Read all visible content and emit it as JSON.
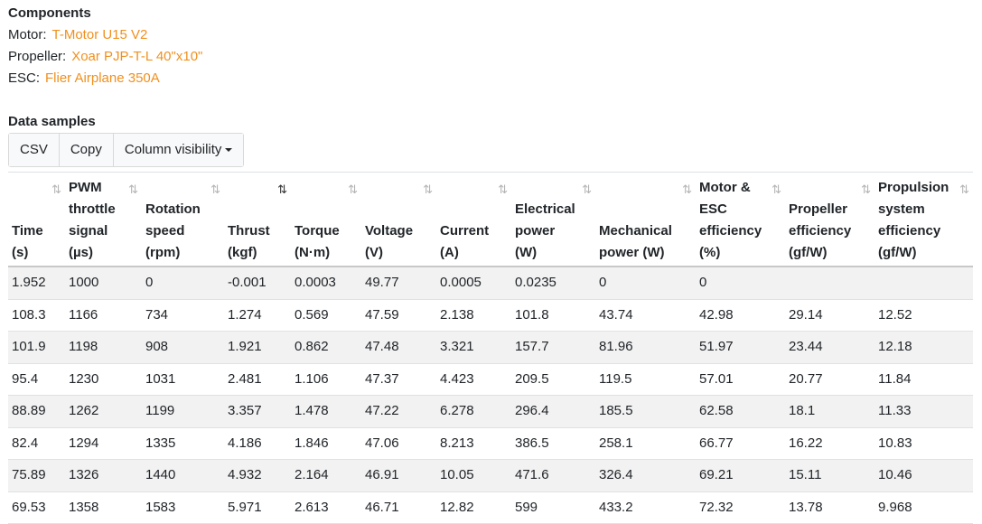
{
  "components": {
    "title": "Components",
    "motor_label": "Motor:",
    "motor_value": "T-Motor U15 V2",
    "propeller_label": "Propeller:",
    "propeller_value": "Xoar PJP-T-L 40\"x10\"",
    "esc_label": "ESC:",
    "esc_value": "Flier Airplane 350A"
  },
  "data_samples": {
    "title": "Data samples",
    "buttons": {
      "csv": "CSV",
      "copy": "Copy",
      "column_visibility": "Column visibility"
    }
  },
  "sort_icon": "⇅",
  "table": {
    "headers": [
      [
        "Time",
        "(s)"
      ],
      [
        "PWM",
        "throttle",
        "signal",
        "(µs)"
      ],
      [
        "Rotation",
        "speed",
        "(rpm)"
      ],
      [
        "Thrust",
        "(kgf)"
      ],
      [
        "Torque",
        "(N·m)"
      ],
      [
        "Voltage",
        "(V)"
      ],
      [
        "Current",
        "(A)"
      ],
      [
        "Electrical",
        "power",
        "(W)"
      ],
      [
        "Mechanical",
        "power (W)"
      ],
      [
        "Motor &",
        "ESC",
        "efficiency",
        "(%)"
      ],
      [
        "Propeller",
        "efficiency",
        "(gf/W)"
      ],
      [
        "Propulsion",
        "system",
        "efficiency",
        "(gf/W)"
      ]
    ],
    "rows": [
      [
        "1.952",
        "1000",
        "0",
        "-0.001",
        "0.0003",
        "49.77",
        "0.0005",
        "0.0235",
        "0",
        "0",
        "",
        ""
      ],
      [
        "108.3",
        "1166",
        "734",
        "1.274",
        "0.569",
        "47.59",
        "2.138",
        "101.8",
        "43.74",
        "42.98",
        "29.14",
        "12.52"
      ],
      [
        "101.9",
        "1198",
        "908",
        "1.921",
        "0.862",
        "47.48",
        "3.321",
        "157.7",
        "81.96",
        "51.97",
        "23.44",
        "12.18"
      ],
      [
        "95.4",
        "1230",
        "1031",
        "2.481",
        "1.106",
        "47.37",
        "4.423",
        "209.5",
        "119.5",
        "57.01",
        "20.77",
        "11.84"
      ],
      [
        "88.89",
        "1262",
        "1199",
        "3.357",
        "1.478",
        "47.22",
        "6.278",
        "296.4",
        "185.5",
        "62.58",
        "18.1",
        "11.33"
      ],
      [
        "82.4",
        "1294",
        "1335",
        "4.186",
        "1.846",
        "47.06",
        "8.213",
        "386.5",
        "258.1",
        "66.77",
        "16.22",
        "10.83"
      ],
      [
        "75.89",
        "1326",
        "1440",
        "4.932",
        "2.164",
        "46.91",
        "10.05",
        "471.6",
        "326.4",
        "69.21",
        "15.11",
        "10.46"
      ],
      [
        "69.53",
        "1358",
        "1583",
        "5.971",
        "2.613",
        "46.71",
        "12.82",
        "599",
        "433.2",
        "72.32",
        "13.78",
        "9.968"
      ]
    ]
  },
  "colors": {
    "link": "#f0901e",
    "stripe": "#f2f2f2"
  }
}
